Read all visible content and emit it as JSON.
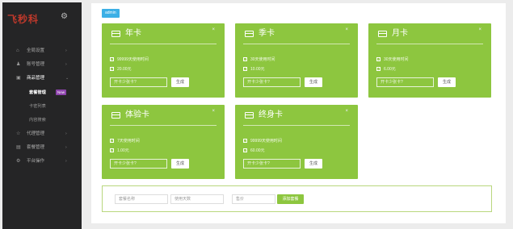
{
  "brand": {
    "logo_text": "飞秒科"
  },
  "sidebar": {
    "items": [
      {
        "label": "全局设置",
        "icon": "home-icon"
      },
      {
        "label": "账号管理",
        "icon": "users-icon"
      },
      {
        "label": "商品管理",
        "icon": "box-icon"
      },
      {
        "label": "代理管理",
        "icon": "star-icon"
      },
      {
        "label": "套餐管理",
        "icon": "list-icon"
      },
      {
        "label": "平台操作",
        "icon": "gear-icon"
      }
    ],
    "sub_items": [
      {
        "label": "套餐管理",
        "badge": "New"
      },
      {
        "label": "卡密列表"
      },
      {
        "label": "内容搜索"
      }
    ]
  },
  "breadcrumb": "admin",
  "cards": [
    {
      "title": "年卡",
      "line1": "99999天使用时间",
      "line2": "20.00元",
      "input_placeholder": "开卡少张卡?",
      "button": "生成"
    },
    {
      "title": "季卡",
      "line1": "30天使用时间",
      "line2": "10.00元",
      "input_placeholder": "开卡少张卡?",
      "button": "生成"
    },
    {
      "title": "月卡",
      "line1": "30天使用时间",
      "line2": "6.00元",
      "input_placeholder": "开卡少张卡?",
      "button": "生成"
    },
    {
      "title": "体验卡",
      "line1": "7天使用时间",
      "line2": "1.00元",
      "input_placeholder": "开卡少张卡?",
      "button": "生成"
    },
    {
      "title": "终身卡",
      "line1": "99999天使用时间",
      "line2": "60.00元",
      "input_placeholder": "开卡少张卡?",
      "button": "生成"
    }
  ],
  "add_form": {
    "name_placeholder": "套餐名称",
    "days_placeholder": "使用天数",
    "price_placeholder": "售价",
    "button": "添加套餐"
  },
  "colors": {
    "sidebar": "#252526",
    "card": "#8dc63f",
    "crumb": "#3cb0e6",
    "badge": "#8e44ad"
  }
}
